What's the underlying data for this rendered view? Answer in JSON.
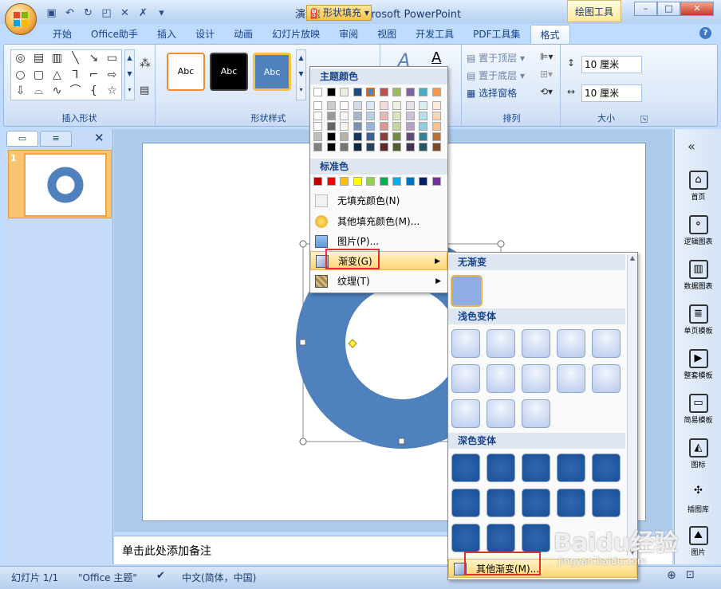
{
  "app": {
    "title": "演示文稿1 - Microsoft PowerPoint",
    "tool_context": "绘图工具",
    "window_buttons": [
      "–",
      "□",
      "✕"
    ]
  },
  "tabs": [
    "开始",
    "Office助手",
    "插入",
    "设计",
    "动画",
    "幻灯片放映",
    "审阅",
    "视图",
    "开发工具",
    "PDF工具集",
    "格式"
  ],
  "active_tab": "格式",
  "ribbon": {
    "groups": {
      "insert_shapes": "插入形状",
      "shape_styles": "形状样式",
      "arrange": "排列",
      "size": "大小"
    },
    "style_thumbs": [
      "Abc",
      "Abc",
      "Abc"
    ],
    "fill_button": "形状填充",
    "arrange_buttons": [
      "置于顶层",
      "置于底层",
      "选择窗格"
    ],
    "height_value": "10 厘米",
    "width_value": "10 厘米"
  },
  "fill_menu": {
    "theme_colors_header": "主题颜色",
    "standard_colors_header": "标准色",
    "theme_top_row": [
      "#ffffff",
      "#000000",
      "#eeece1",
      "#1f497d",
      "#4f81bd",
      "#c0504d",
      "#9bbb59",
      "#8064a2",
      "#4bacc6",
      "#f79646"
    ],
    "standard_colors": [
      "#c00000",
      "#ff0000",
      "#ffc000",
      "#ffff00",
      "#92d050",
      "#00b050",
      "#00b0f0",
      "#0070c0",
      "#002060",
      "#7030a0"
    ],
    "items": {
      "no_fill": "无填充颜色(N)",
      "more_colors": "其他填充颜色(M)...",
      "picture": "图片(P)...",
      "gradient": "渐变(G)",
      "texture": "纹理(T)"
    }
  },
  "gradient_menu": {
    "no_gradient": "无渐变",
    "light_variants": "浅色变体",
    "dark_variants": "深色变体",
    "more_gradients": "其他渐变(M)..."
  },
  "notes_placeholder": "单击此处添加备注",
  "slide_number": "1",
  "status": {
    "slide": "幻灯片 1/1",
    "theme": "\"Office 主题\"",
    "language": "中文(简体，中国)"
  },
  "right_sidebar": [
    "首页",
    "逻辑图表",
    "数据图表",
    "单页模板",
    "整套模板",
    "简易模板",
    "图标",
    "插图库",
    "图片"
  ],
  "watermark": {
    "main": "Baidu经验",
    "sub": "jingyan.baidu.com"
  }
}
